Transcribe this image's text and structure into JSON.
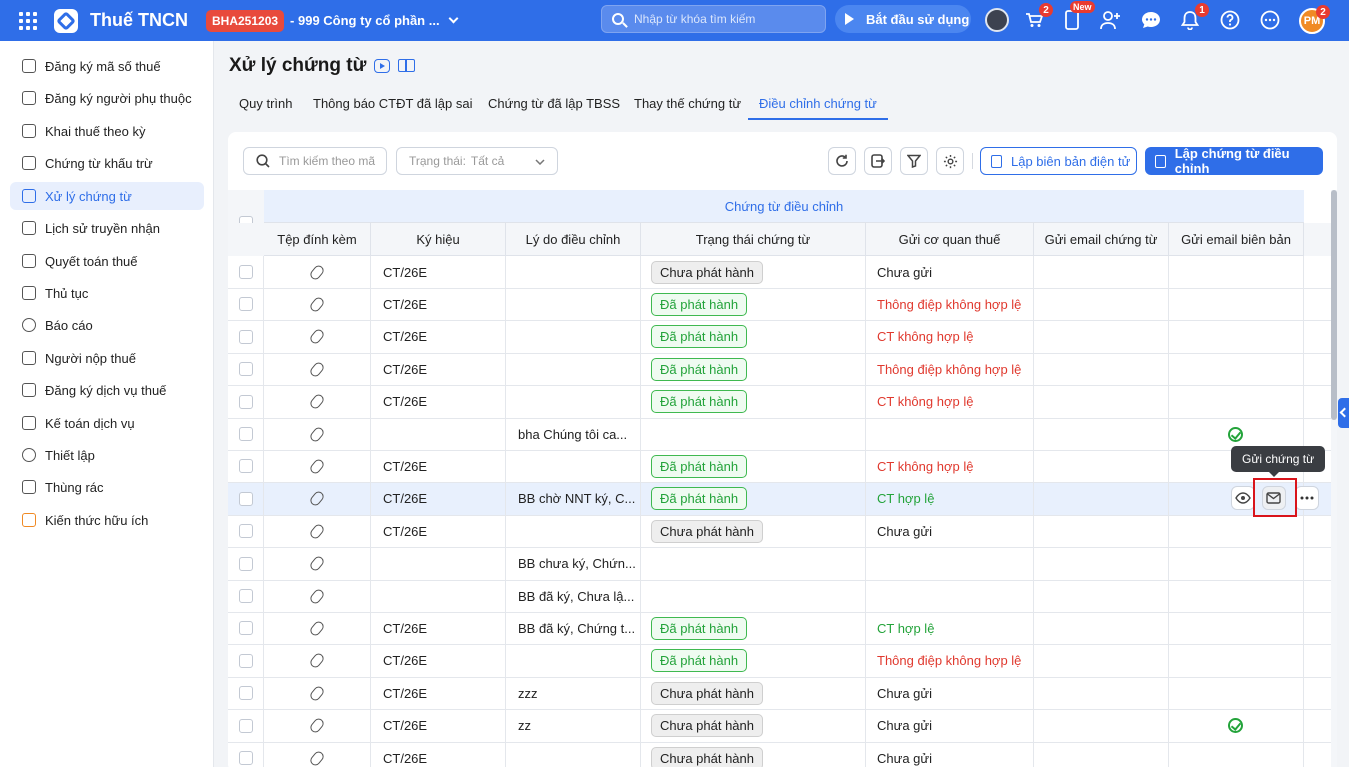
{
  "topbar": {
    "app_title": "Thuế TNCN",
    "company_code": "BHA251203",
    "company_name": "- 999 Công ty cổ phần ...",
    "search_placeholder": "Nhập từ khóa tìm kiếm",
    "start_label": "Bắt đầu sử dụng",
    "cart_count": "2",
    "new_label": "New",
    "notif_count": "1",
    "avatar_initials": "PM",
    "avatar_count": "2"
  },
  "sidebar": {
    "items": [
      {
        "label": "Đăng ký mã số thuế",
        "icon": "id-scan-icon"
      },
      {
        "label": "Đăng ký người phụ thuộc",
        "icon": "people-icon"
      },
      {
        "label": "Khai thuế theo kỳ",
        "icon": "document-icon"
      },
      {
        "label": "Chứng từ khấu trừ",
        "icon": "folder-icon"
      },
      {
        "label": "Xử lý chứng từ",
        "icon": "document-check-icon"
      },
      {
        "label": "Lịch sử truyền nhận",
        "icon": "transfer-icon"
      },
      {
        "label": "Quyết toán thuế",
        "icon": "folder-icon"
      },
      {
        "label": "Thủ tục",
        "icon": "folder-icon"
      },
      {
        "label": "Báo cáo",
        "icon": "pie-chart-icon"
      },
      {
        "label": "Người nộp thuế",
        "icon": "user-card-icon"
      },
      {
        "label": "Đăng ký dịch vụ thuế",
        "icon": "register-icon"
      },
      {
        "label": "Kế toán dịch vụ",
        "icon": "accounting-icon"
      },
      {
        "label": "Thiết lập",
        "icon": "gear-icon"
      },
      {
        "label": "Thùng rác",
        "icon": "trash-icon"
      },
      {
        "label": "Kiến thức hữu ích",
        "icon": "bulb-icon"
      }
    ],
    "active_index": 4
  },
  "page": {
    "title": "Xử lý chứng từ",
    "tabs": [
      "Quy trình",
      "Thông báo CTĐT đã lập sai",
      "Chứng từ đã lập TBSS",
      "Thay thế chứng từ",
      "Điều chỉnh chứng từ"
    ],
    "active_tab": 4
  },
  "toolbar": {
    "search_placeholder": "Tìm kiếm theo mã",
    "status_label": "Trạng thái:",
    "status_value": "Tất cả",
    "btn_bien_ban": "Lập biên bản điện tử",
    "btn_dieu_chinh": "Lập chứng từ điều chỉnh"
  },
  "table": {
    "group_header": "Chứng từ điều chỉnh",
    "columns": [
      "Tệp đính kèm",
      "Ký hiệu",
      "Lý do điều chỉnh",
      "Trạng thái chứng từ",
      "Gửi cơ quan thuế",
      "Gửi email chứng từ",
      "Gửi email biên bản"
    ],
    "rows": [
      {
        "ky_hieu": "CT/26E",
        "ly_do": "",
        "trang_thai": "Chưa phát hành",
        "tt_style": "gray",
        "gui_cqt": "Chưa gửi",
        "cqt_style": "",
        "email_bb": false,
        "highlight": false
      },
      {
        "ky_hieu": "CT/26E",
        "ly_do": "",
        "trang_thai": "Đã phát hành",
        "tt_style": "green",
        "gui_cqt": "Thông điệp không hợp lệ",
        "cqt_style": "red",
        "email_bb": false,
        "highlight": false
      },
      {
        "ky_hieu": "CT/26E",
        "ly_do": "",
        "trang_thai": "Đã phát hành",
        "tt_style": "green",
        "gui_cqt": "CT không hợp lệ",
        "cqt_style": "red",
        "email_bb": false,
        "highlight": false
      },
      {
        "ky_hieu": "CT/26E",
        "ly_do": "",
        "trang_thai": "Đã phát hành",
        "tt_style": "green",
        "gui_cqt": "Thông điệp không hợp lệ",
        "cqt_style": "red",
        "email_bb": false,
        "highlight": false
      },
      {
        "ky_hieu": "CT/26E",
        "ly_do": "",
        "trang_thai": "Đã phát hành",
        "tt_style": "green",
        "gui_cqt": "CT không hợp lệ",
        "cqt_style": "red",
        "email_bb": false,
        "highlight": false
      },
      {
        "ky_hieu": "",
        "ly_do": "bha Chúng tôi ca...",
        "trang_thai": "",
        "tt_style": "",
        "gui_cqt": "",
        "cqt_style": "",
        "email_bb": true,
        "highlight": false
      },
      {
        "ky_hieu": "CT/26E",
        "ly_do": "",
        "trang_thai": "Đã phát hành",
        "tt_style": "green",
        "gui_cqt": "CT không hợp lệ",
        "cqt_style": "red",
        "email_bb": false,
        "highlight": false
      },
      {
        "ky_hieu": "CT/26E",
        "ly_do": "BB chờ NNT ký, C...",
        "trang_thai": "Đã phát hành",
        "tt_style": "green",
        "gui_cqt": "CT hợp lệ",
        "cqt_style": "green",
        "email_bb": false,
        "highlight": true
      },
      {
        "ky_hieu": "CT/26E",
        "ly_do": "",
        "trang_thai": "Chưa phát hành",
        "tt_style": "gray",
        "gui_cqt": "Chưa gửi",
        "cqt_style": "",
        "email_bb": false,
        "highlight": false
      },
      {
        "ky_hieu": "",
        "ly_do": "BB chưa ký, Chứn...",
        "trang_thai": "",
        "tt_style": "",
        "gui_cqt": "",
        "cqt_style": "",
        "email_bb": false,
        "highlight": false
      },
      {
        "ky_hieu": "",
        "ly_do": "BB đã ký, Chưa lậ...",
        "trang_thai": "",
        "tt_style": "",
        "gui_cqt": "",
        "cqt_style": "",
        "email_bb": false,
        "highlight": false
      },
      {
        "ky_hieu": "CT/26E",
        "ly_do": "BB đã ký, Chứng t...",
        "trang_thai": "Đã phát hành",
        "tt_style": "green",
        "gui_cqt": "CT hợp lệ",
        "cqt_style": "green",
        "email_bb": false,
        "highlight": false
      },
      {
        "ky_hieu": "CT/26E",
        "ly_do": "",
        "trang_thai": "Đã phát hành",
        "tt_style": "green",
        "gui_cqt": "Thông điệp không hợp lệ",
        "cqt_style": "red",
        "email_bb": false,
        "highlight": false
      },
      {
        "ky_hieu": "CT/26E",
        "ly_do": "zzz",
        "trang_thai": "Chưa phát hành",
        "tt_style": "gray",
        "gui_cqt": "Chưa gửi",
        "cqt_style": "",
        "email_bb": false,
        "highlight": false
      },
      {
        "ky_hieu": "CT/26E",
        "ly_do": "zz",
        "trang_thai": "Chưa phát hành",
        "tt_style": "gray",
        "gui_cqt": "Chưa gửi",
        "cqt_style": "",
        "email_bb": true,
        "highlight": false
      },
      {
        "ky_hieu": "CT/26E",
        "ly_do": "",
        "trang_thai": "Chưa phát hành",
        "tt_style": "gray",
        "gui_cqt": "Chưa gửi",
        "cqt_style": "",
        "email_bb": false,
        "highlight": false
      }
    ]
  },
  "tooltip": {
    "text": "Gửi chứng từ"
  },
  "colors": {
    "primary": "#2f6ee8",
    "danger": "#e0392e",
    "success": "#23a33a",
    "highlight_box": "#d9141b"
  }
}
